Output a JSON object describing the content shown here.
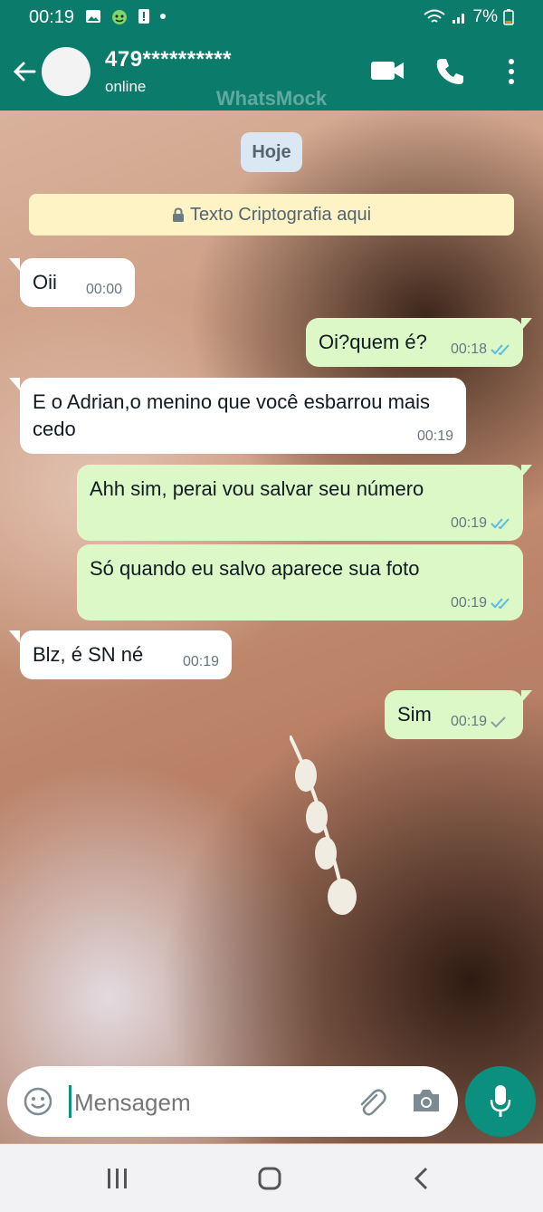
{
  "status_bar": {
    "time": "00:19",
    "battery": "7%"
  },
  "header": {
    "contact_name": "479**********",
    "contact_status": "online",
    "watermark": "WhatsMock"
  },
  "chat": {
    "day_label": "Hoje",
    "encryption_notice": "Texto Criptografia aqui",
    "messages": [
      {
        "direction": "in",
        "text": "Oii",
        "time": "00:00"
      },
      {
        "direction": "out",
        "text": "Oi?quem é?",
        "time": "00:18",
        "ticks": "read"
      },
      {
        "direction": "in",
        "text": "E o Adrian,o menino que você esbarrou mais cedo",
        "time": "00:19"
      },
      {
        "direction": "out",
        "text": "Ahh sim, perai vou salvar seu número",
        "time": "00:19",
        "ticks": "read"
      },
      {
        "direction": "out",
        "text": "Só quando eu salvo aparece sua foto",
        "time": "00:19",
        "ticks": "read"
      },
      {
        "direction": "in",
        "text": "Blz, é SN né",
        "time": "00:19"
      },
      {
        "direction": "out",
        "text": "Sim",
        "time": "00:19",
        "ticks": "sent"
      }
    ]
  },
  "composer": {
    "placeholder": "Mensagem"
  },
  "colors": {
    "header": "#0b7b6b",
    "accent": "#0b8f7e",
    "outgoing": "#dcf8c6",
    "incoming": "#ffffff",
    "read_tick": "#53bdeb"
  }
}
